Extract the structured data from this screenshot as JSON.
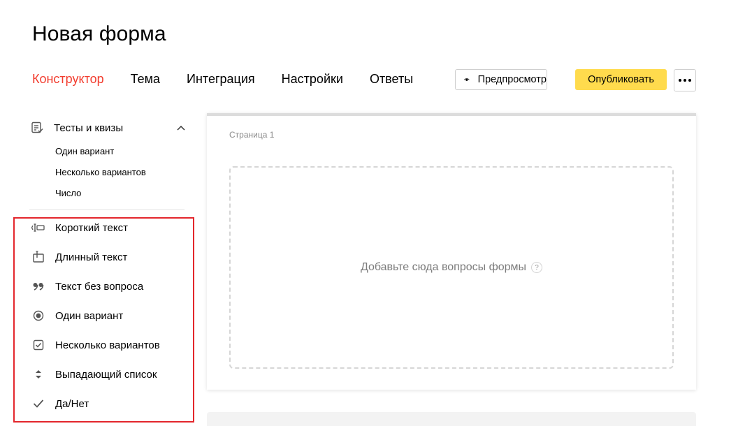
{
  "page": {
    "title": "Новая форма"
  },
  "nav": {
    "tabs": [
      {
        "label": "Конструктор",
        "active": true
      },
      {
        "label": "Тема",
        "active": false
      },
      {
        "label": "Интеграция",
        "active": false
      },
      {
        "label": "Настройки",
        "active": false
      },
      {
        "label": "Ответы",
        "active": false
      }
    ],
    "preview_label": "Предпросмотр",
    "publish_label": "Опубликовать"
  },
  "sidebar": {
    "group": {
      "label": "Тесты и квизы",
      "icon": "quiz-icon",
      "expanded": true,
      "items": [
        {
          "label": "Один вариант"
        },
        {
          "label": "Несколько вариантов"
        },
        {
          "label": "Число"
        }
      ]
    },
    "fields": [
      {
        "label": "Короткий текст",
        "icon": "short-text-icon"
      },
      {
        "label": "Длинный текст",
        "icon": "long-text-icon"
      },
      {
        "label": "Текст без вопроса",
        "icon": "quote-icon"
      },
      {
        "label": "Один вариант",
        "icon": "radio-icon"
      },
      {
        "label": "Несколько вариантов",
        "icon": "checkbox-icon"
      },
      {
        "label": "Выпадающий список",
        "icon": "dropdown-icon"
      },
      {
        "label": "Да/Нет",
        "icon": "check-icon"
      }
    ]
  },
  "main": {
    "page_label": "Страница 1",
    "dropzone_text": "Добавьте сюда вопросы формы",
    "help_glyph": "?"
  },
  "colors": {
    "accent": "#f23c2e",
    "publish": "#ffdb4d",
    "highlight": "#e3262c"
  }
}
